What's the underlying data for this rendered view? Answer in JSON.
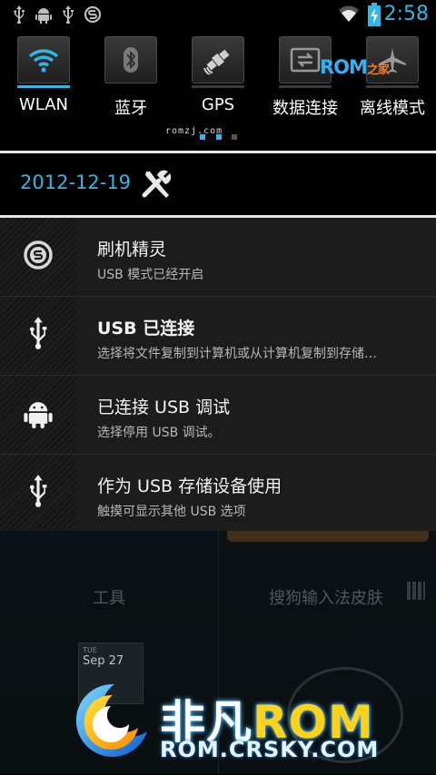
{
  "status_bar": {
    "icons": [
      "usb-icon",
      "android-debug-icon",
      "usb-icon",
      "flash-app-icon"
    ],
    "right_icons": [
      "wifi-signal-icon",
      "battery-charging-icon"
    ],
    "time": "2:58",
    "accent": "#33b5e5"
  },
  "quick_toggles": {
    "items": [
      {
        "label": "WLAN",
        "icon": "wifi-icon",
        "active": true
      },
      {
        "label": "蓝牙",
        "icon": "bluetooth-icon",
        "active": false
      },
      {
        "label": "GPS",
        "icon": "gps-satellite-icon",
        "active": false
      },
      {
        "label": "数据连接",
        "icon": "data-connection-icon",
        "active": false
      },
      {
        "label": "离线模式",
        "icon": "airplane-icon",
        "active": false
      }
    ],
    "brand_small": "romzj.com",
    "brand_logo_text": "ROM之家"
  },
  "date_row": {
    "date": "2012-12-19",
    "settings_icon": "tools-icon"
  },
  "notifications": [
    {
      "title": "刷机精灵",
      "subtitle": "USB 模式已经开启",
      "icon": "flash-spirit-icon"
    },
    {
      "title": "USB 已连接",
      "subtitle": "选择将文件复制到计算机或从计算机复制到存储…",
      "icon": "usb-icon"
    },
    {
      "title": "已连接 USB 调试",
      "subtitle": "选择停用 USB 调试。",
      "icon": "android-icon"
    },
    {
      "title": "作为 USB 存储设备使用",
      "subtitle": "触摸可显示其他 USB 选项",
      "icon": "usb-icon"
    }
  ],
  "homescreen": {
    "labels": [
      "工具",
      "搜狗输入法皮肤"
    ],
    "calendar_day": "TUE",
    "calendar_date": "Sep 27"
  },
  "watermark": {
    "title_cn": "非凡",
    "title_rom": "ROM",
    "url": "ROM.CRSKY.COM"
  }
}
